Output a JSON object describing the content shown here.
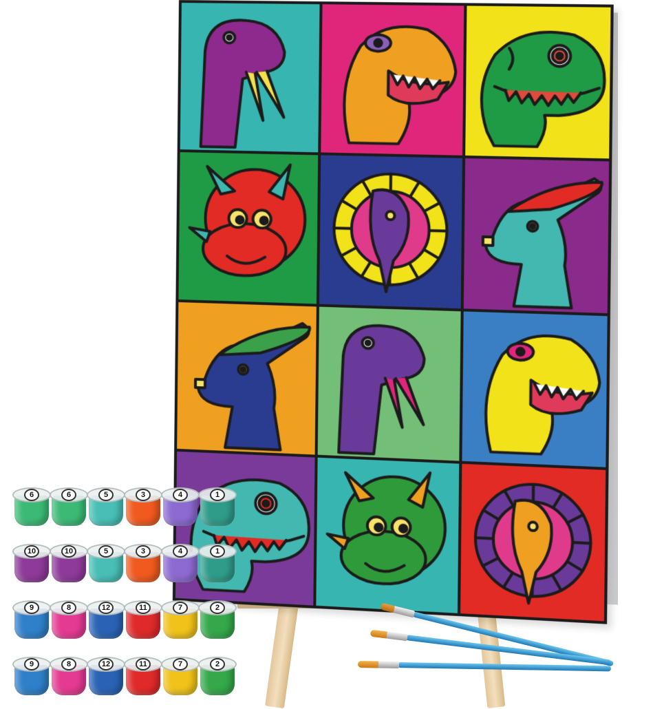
{
  "colors": {
    "canvas_outline": "#1b1b1b",
    "tiles": [
      {
        "bg": "#37b5b0",
        "dino": "#8e2a8e",
        "accent": "#f4e04a",
        "kind": "long-neck"
      },
      {
        "bg": "#e0267a",
        "dino": "#f0a020",
        "accent": "#8b5fb5",
        "kind": "t-rex"
      },
      {
        "bg": "#f2e21a",
        "dino": "#1f9a45",
        "accent": "#e04a3a",
        "kind": "t-rex-smile"
      },
      {
        "bg": "#1f9a45",
        "dino": "#e12b24",
        "accent": "#3fb6b0",
        "kind": "triceratops"
      },
      {
        "bg": "#2a3c8f",
        "dino": "#6a3a9a",
        "accent": "#f2e21a",
        "kind": "frill"
      },
      {
        "bg": "#8a2a8a",
        "dino": "#43b8b0",
        "accent": "#e12b24",
        "kind": "crested"
      },
      {
        "bg": "#f0a020",
        "dino": "#2a3c8f",
        "accent": "#3aa04a",
        "kind": "crested"
      },
      {
        "bg": "#74bf78",
        "dino": "#6a3a9a",
        "accent": "#e0267a",
        "kind": "long-neck"
      },
      {
        "bg": "#3a7fc4",
        "dino": "#f2e21a",
        "accent": "#e0267a",
        "kind": "t-rex"
      },
      {
        "bg": "#7a3a9a",
        "dino": "#43b8b0",
        "accent": "#e12b24",
        "kind": "t-rex-smile"
      },
      {
        "bg": "#37b5b0",
        "dino": "#2e9a3a",
        "accent": "#f0a020",
        "kind": "triceratops"
      },
      {
        "bg": "#e12b24",
        "dino": "#f0a020",
        "accent": "#6a3a9a",
        "kind": "frill"
      }
    ]
  },
  "pots": [
    [
      {
        "n": "6",
        "c": "#3cba75"
      },
      {
        "n": "6",
        "c": "#3cba75"
      },
      {
        "n": "5",
        "c": "#47bfb5"
      },
      {
        "n": "3",
        "c": "#f05a1e"
      },
      {
        "n": "4",
        "c": "#8d6ad2"
      },
      {
        "n": "1",
        "c": "#2f9c8a"
      }
    ],
    [
      {
        "n": "10",
        "c": "#8e3a9a"
      },
      {
        "n": "10",
        "c": "#8e3a9a"
      },
      {
        "n": "5",
        "c": "#47bfb5"
      },
      {
        "n": "3",
        "c": "#f05a1e"
      },
      {
        "n": "4",
        "c": "#8d6ad2"
      },
      {
        "n": "1",
        "c": "#2f9c8a"
      }
    ],
    [
      {
        "n": "9",
        "c": "#2f7fc9"
      },
      {
        "n": "8",
        "c": "#e53a92"
      },
      {
        "n": "12",
        "c": "#2a63b5"
      },
      {
        "n": "11",
        "c": "#e02a2a"
      },
      {
        "n": "7",
        "c": "#f0c21a"
      },
      {
        "n": "2",
        "c": "#34a84a"
      }
    ],
    [
      {
        "n": "9",
        "c": "#2f7fc9"
      },
      {
        "n": "8",
        "c": "#e53a92"
      },
      {
        "n": "12",
        "c": "#2a63b5"
      },
      {
        "n": "11",
        "c": "#e02a2a"
      },
      {
        "n": "7",
        "c": "#f0c21a"
      },
      {
        "n": "2",
        "c": "#34a84a"
      }
    ]
  ],
  "icons": {
    "easel": "easel-icon",
    "brush": "paint-brush-icon",
    "pot": "paint-pot-icon"
  }
}
